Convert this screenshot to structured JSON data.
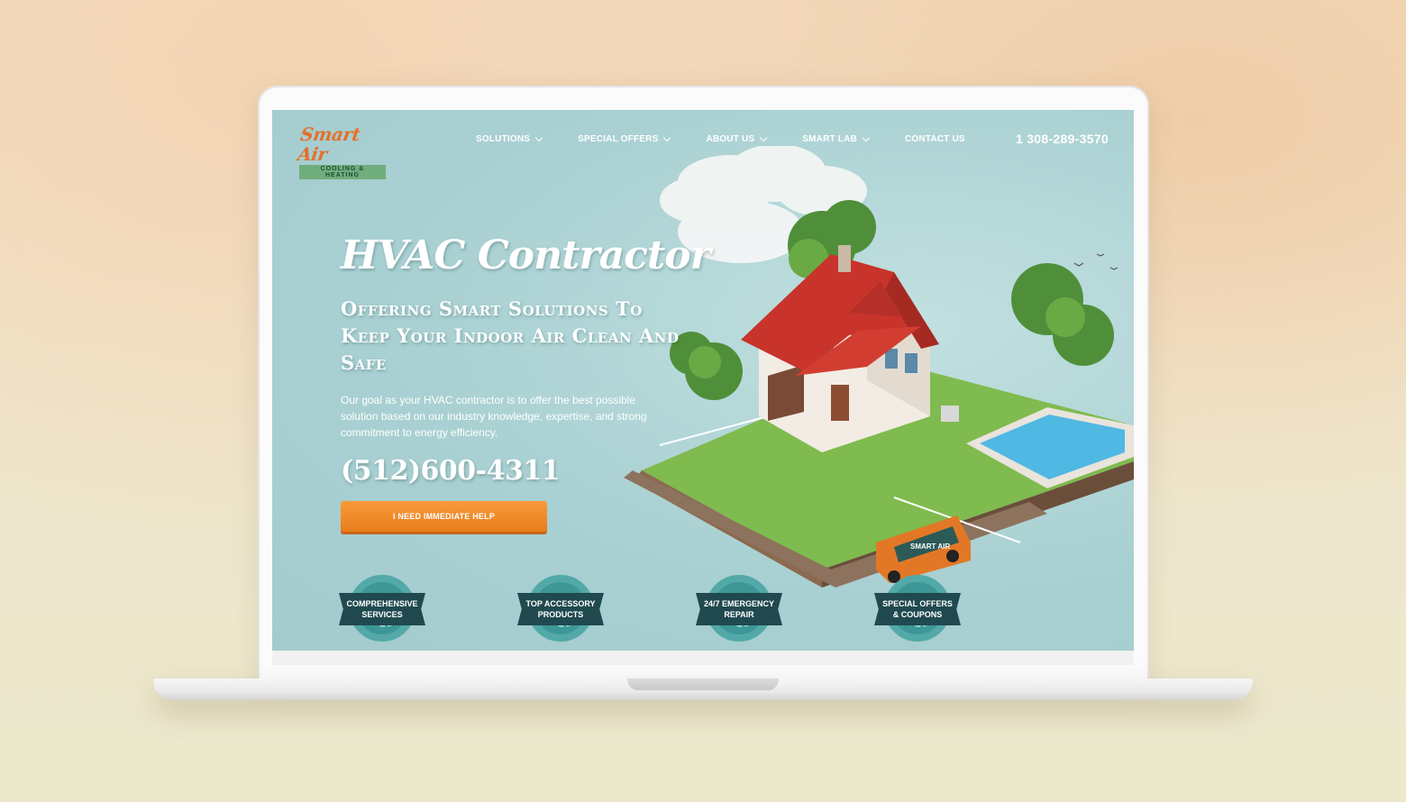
{
  "brand": {
    "name": "Smart Air",
    "tagline": "COOLING & HEATING"
  },
  "nav": [
    {
      "label": "SOLUTIONS",
      "dropdown": true
    },
    {
      "label": "SPECIAL OFFERS",
      "dropdown": true
    },
    {
      "label": "ABOUT US",
      "dropdown": true
    },
    {
      "label": "SMART LAB",
      "dropdown": true
    },
    {
      "label": "CONTACT US",
      "dropdown": false
    }
  ],
  "header_phone": "1 308-289-3570",
  "hero": {
    "script_title": "HVAC Contractor",
    "title": "Offering Smart Solutions To Keep Your Indoor Air Clean And Safe",
    "description": "Our goal as your HVAC contractor is to offer the best possible solution based on our industry knowledge, expertise, and strong commitment to energy efficiency.",
    "phone": "(512)600-4311",
    "cta_label": "I NEED IMMEDIATE HELP"
  },
  "van_label": "SMART AIR",
  "badges": [
    {
      "label": "COMPREHENSIVE\nSERVICES"
    },
    {
      "label": "TOP ACCESSORY\nPRODUCTS"
    },
    {
      "label": "24/7 EMERGENCY\nREPAIR"
    },
    {
      "label": "SPECIAL OFFERS\n& COUPONS"
    }
  ],
  "colors": {
    "accent": "#EA7D1C",
    "screen_bg": "#A9D0D2",
    "badge_dark": "#204A4F",
    "badge_teal": "#3D9796"
  }
}
